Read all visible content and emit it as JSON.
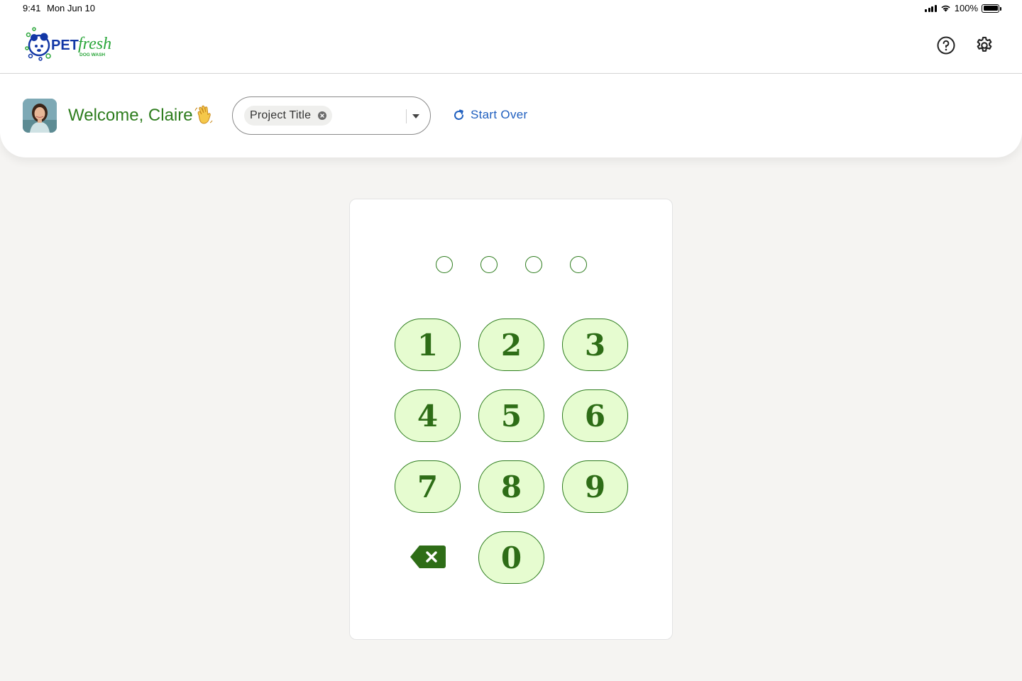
{
  "status_bar": {
    "time": "9:41",
    "date": "Mon Jun 10",
    "battery": "100%"
  },
  "header": {
    "logo_text_pet": "PET",
    "logo_text_fresh": "fresh",
    "logo_text_sub": "DOG WASH",
    "help_icon": "help-circle-icon",
    "settings_icon": "gear-icon"
  },
  "welcome": {
    "greeting": "Welcome, Claire",
    "emoji": "waving-hand-icon"
  },
  "project_select": {
    "chip_label": "Project Title"
  },
  "start_over": {
    "label": "Start Over"
  },
  "pin": {
    "length": 4,
    "filled": 0
  },
  "keypad": {
    "keys": [
      "1",
      "2",
      "3",
      "4",
      "5",
      "6",
      "7",
      "8",
      "9",
      "0"
    ]
  },
  "colors": {
    "brand_green": "#2e7d1e",
    "key_fill": "#e6fcd0",
    "link_blue": "#1f5fbf",
    "logo_blue": "#1237a6"
  }
}
